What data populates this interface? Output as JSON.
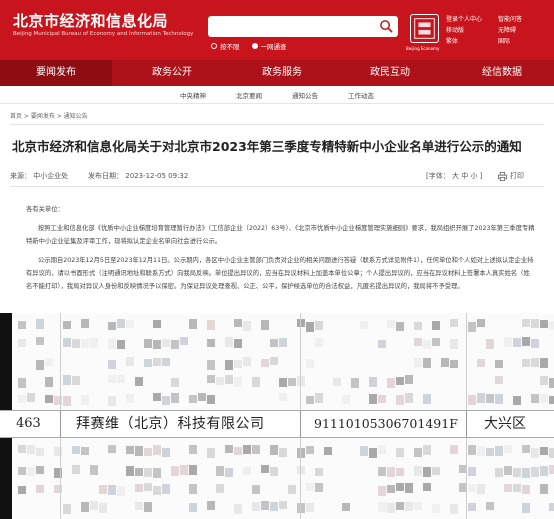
{
  "header": {
    "title": "北京市经济和信息化局",
    "subtitle": "Beijing Municipal Bureau of Economy and Information Technology",
    "search_options": [
      "按不限",
      "一网通查"
    ],
    "seal_caption": "Beijing Economy",
    "quick_links": [
      {
        "label": "登录个人中心"
      },
      {
        "label": "移动版"
      },
      {
        "label": "繁体"
      },
      {
        "label": "智能问答"
      },
      {
        "label": "无障碍"
      },
      {
        "label": "国际"
      }
    ]
  },
  "nav": {
    "items": [
      "要闻发布",
      "政务公开",
      "政务服务",
      "政民互动",
      "经信数据"
    ],
    "sub_items": [
      "中央精神",
      "北京要闻",
      "通知公告",
      "工作动态"
    ]
  },
  "breadcrumb": "首页 > 要闻发布 > 通知公告",
  "article": {
    "title": "北京市经济和信息化局关于对北京市2023年第三季度专精特新中小企业名单进行公示的通知",
    "source_label": "来源：",
    "source": "中小企业处",
    "date_label": "发布日期：",
    "date": "2023-12-05 09:32",
    "font_label": "[字体：",
    "font_sizes": [
      "大",
      "中",
      "小"
    ],
    "font_close": "]",
    "print_label": "打印",
    "salutation": "各有关单位：",
    "para1": "按照工业和信息化部《优质中小企业梯度培育管理暂行办法》（工信部企业〔2022〕63号）、《北京市优质中小企业梯度管理实施细则》要求，我局组织开展了2023年第三季度专精特新中小企业征集及评审工作，现将拟认定企业名单向社会进行公示。",
    "para2": "公示期自2023年12月5日至2023年12月11日。公示期内，各区中小企业主管部门负责对企业的相关问题进行答疑（联系方式详见附件1），任何单位和个人如对上述拟认定企业持有异议的，请以书面形式（注明通讯地址和联系方式）向我局反映。单位提出异议的，应当在异议材料上加盖本单位公章；个人提出异议的，应当在异议材料上签署本人真实姓名（姓名不能打印），我局对异议人身份和反映情况予以保密。为保证异议处理查视、公正、公平，保护候选单位的合法权益，凡匿名提出异议的，我局将不予受理。"
  },
  "table_row": {
    "index": "463",
    "company": "拜赛维（北京）科技有限公司",
    "code": "91110105306701491F",
    "district": "大兴区"
  },
  "colors": {
    "brand_red": "#c8141c",
    "nav_red": "#ad1119"
  }
}
